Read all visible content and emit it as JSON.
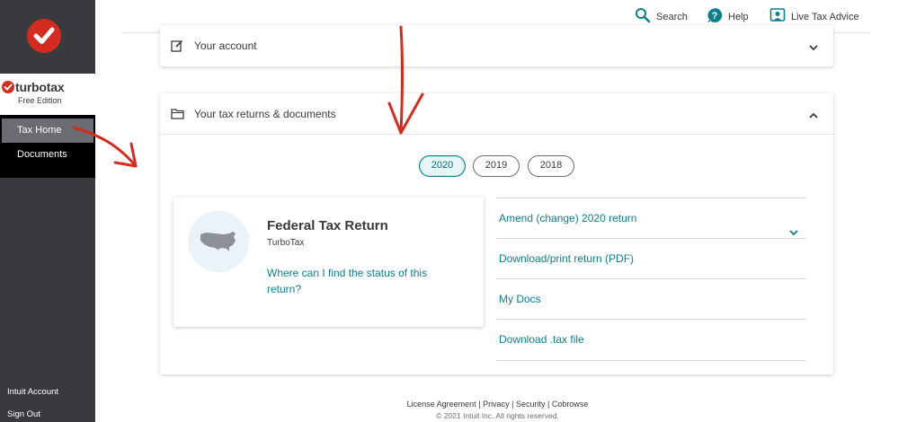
{
  "brand": {
    "name": "turbotax",
    "edition": "Free Edition",
    "accent": "#d52b1e"
  },
  "sidebar": {
    "items": [
      {
        "label": "Tax Home",
        "active": true
      },
      {
        "label": "Documents",
        "active": false
      }
    ],
    "bottom": [
      {
        "label": "Intuit Account"
      },
      {
        "label": "Sign Out"
      }
    ]
  },
  "header": {
    "search_label": "Search",
    "help_label": "Help",
    "advice_label": "Live Tax Advice",
    "icons": [
      "search-icon",
      "help-icon",
      "live-advice-icon"
    ]
  },
  "account_card": {
    "title": "Your account",
    "icon": "edit-icon",
    "expanded": false
  },
  "returns_card": {
    "title": "Your tax returns & documents",
    "icon": "folder-icon",
    "expanded": true,
    "years": [
      "2020",
      "2019",
      "2018"
    ],
    "selected_year": "2020",
    "federal": {
      "title": "Federal Tax Return",
      "subtitle": "TurboTax",
      "status_link": "Where can I find the status of this return?",
      "icon": "us-map-icon"
    },
    "actions": [
      {
        "label": "Amend (change) 2020 return",
        "has_chevron": true
      },
      {
        "label": "Download/print return (PDF)",
        "has_chevron": false
      },
      {
        "label": "My Docs",
        "has_chevron": false
      },
      {
        "label": "Download .tax file",
        "has_chevron": false
      }
    ]
  },
  "footer": {
    "links": [
      "License Agreement",
      "Privacy",
      "Security",
      "Cobrowse"
    ],
    "separator": "|",
    "copyright": "© 2021 Intuit Inc. All rights reserved."
  },
  "colors": {
    "sidebar_bg": "#393a3d",
    "link": "#0d7f8c",
    "annotation": "#d52b1e"
  }
}
